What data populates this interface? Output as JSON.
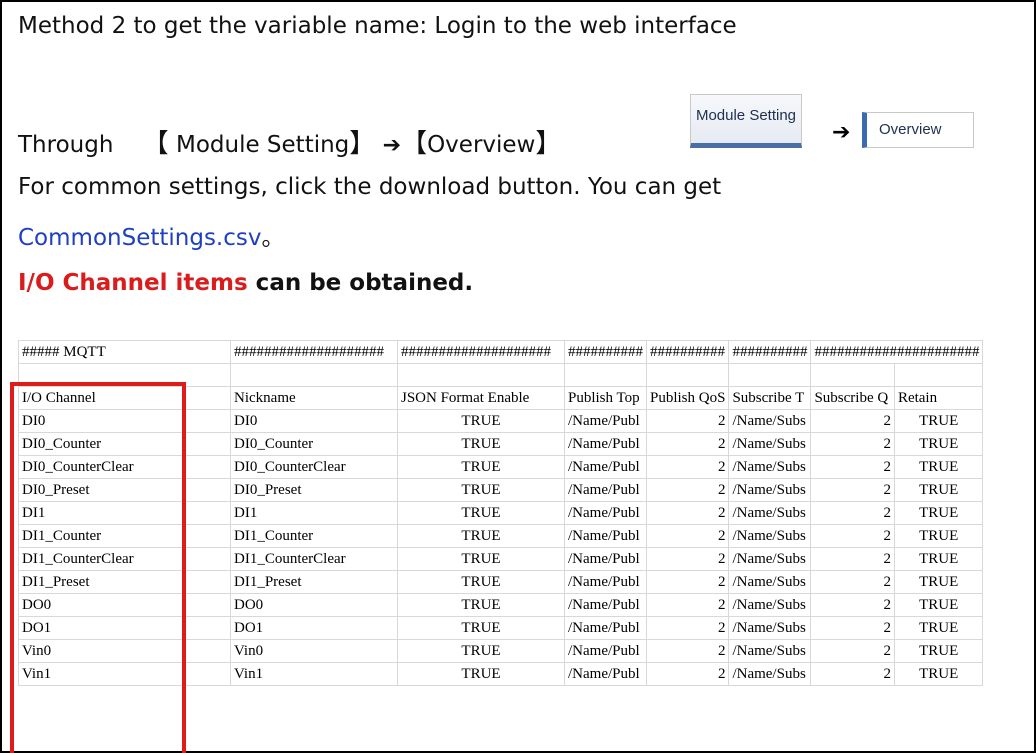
{
  "text": {
    "line1": "Method 2 to get the variable name: Login to the web interface",
    "through": "Through",
    "step1_open": "【",
    "step1_label": "Module Setting",
    "step1_close": "】",
    "arrow": "➔",
    "step2_open": "【",
    "step2_label": "Overview",
    "step2_close": "】",
    "line3": "For common settings, click the download button. You can get",
    "csv_file": "CommonSettings.csv",
    "csv_suffix": "。",
    "line5_red": "I/O Channel items",
    "line5_rest": " can be obtained."
  },
  "buttons": {
    "module_setting": "Module Setting",
    "overview": "Overview"
  },
  "colors": {
    "link_blue": "#1f3fc2",
    "highlight_red": "#d91c1c",
    "box_red": "#e01b1b"
  },
  "sheet": {
    "row0": [
      "##### MQTT",
      "####################",
      "####################",
      "##########",
      "##########",
      "##########",
      "######################"
    ],
    "headers": [
      "I/O Channel",
      "Nickname",
      "JSON Format Enable",
      "Publish Top",
      "Publish QoS",
      "Subscribe T",
      "Subscribe Q",
      "Retain"
    ],
    "rows": [
      [
        "DI0",
        "DI0",
        "TRUE",
        "/Name/Publ",
        "2",
        "/Name/Subs",
        "2",
        "TRUE"
      ],
      [
        "DI0_Counter",
        "DI0_Counter",
        "TRUE",
        "/Name/Publ",
        "2",
        "/Name/Subs",
        "2",
        "TRUE"
      ],
      [
        "DI0_CounterClear",
        "DI0_CounterClear",
        "TRUE",
        "/Name/Publ",
        "2",
        "/Name/Subs",
        "2",
        "TRUE"
      ],
      [
        "DI0_Preset",
        "DI0_Preset",
        "TRUE",
        "/Name/Publ",
        "2",
        "/Name/Subs",
        "2",
        "TRUE"
      ],
      [
        "DI1",
        "DI1",
        "TRUE",
        "/Name/Publ",
        "2",
        "/Name/Subs",
        "2",
        "TRUE"
      ],
      [
        "DI1_Counter",
        "DI1_Counter",
        "TRUE",
        "/Name/Publ",
        "2",
        "/Name/Subs",
        "2",
        "TRUE"
      ],
      [
        "DI1_CounterClear",
        "DI1_CounterClear",
        "TRUE",
        "/Name/Publ",
        "2",
        "/Name/Subs",
        "2",
        "TRUE"
      ],
      [
        "DI1_Preset",
        "DI1_Preset",
        "TRUE",
        "/Name/Publ",
        "2",
        "/Name/Subs",
        "2",
        "TRUE"
      ],
      [
        "DO0",
        "DO0",
        "TRUE",
        "/Name/Publ",
        "2",
        "/Name/Subs",
        "2",
        "TRUE"
      ],
      [
        "DO1",
        "DO1",
        "TRUE",
        "/Name/Publ",
        "2",
        "/Name/Subs",
        "2",
        "TRUE"
      ],
      [
        "Vin0",
        "Vin0",
        "TRUE",
        "/Name/Publ",
        "2",
        "/Name/Subs",
        "2",
        "TRUE"
      ],
      [
        "Vin1",
        "Vin1",
        "TRUE",
        "/Name/Publ",
        "2",
        "/Name/Subs",
        "2",
        "TRUE"
      ]
    ]
  }
}
